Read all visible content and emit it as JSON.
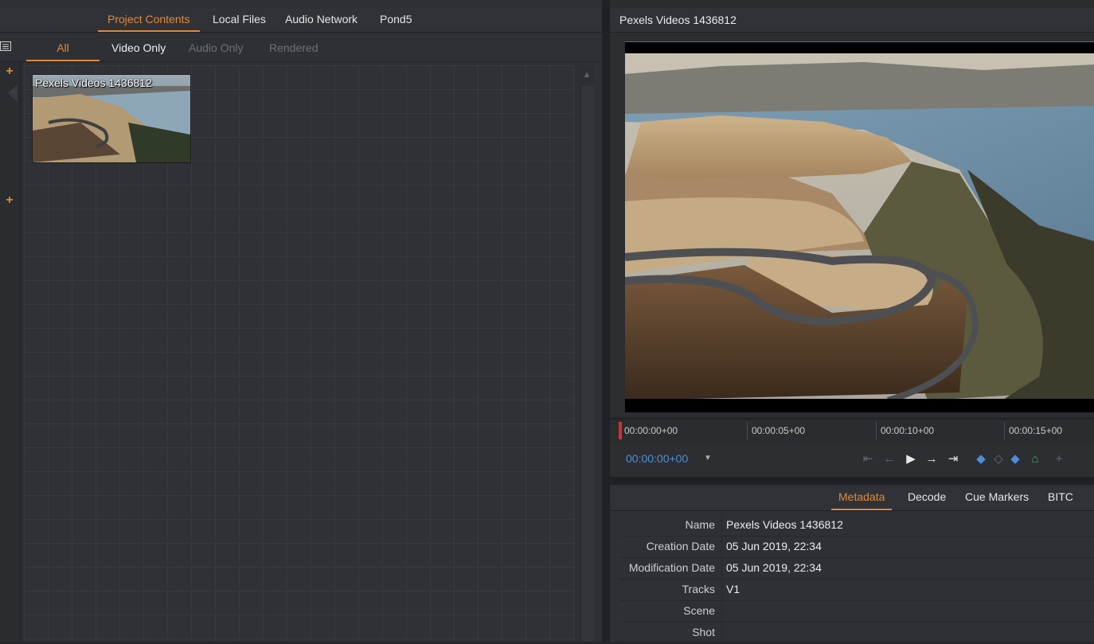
{
  "left_panel": {
    "tabs": [
      "Project Contents",
      "Local Files",
      "Audio Network",
      "Pond5"
    ],
    "active_tab": "Project Contents",
    "filters": [
      "All",
      "Video Only",
      "Audio Only",
      "Rendered"
    ],
    "active_filter": "All",
    "clips": [
      {
        "title": "Pexels Videos 1436812"
      }
    ]
  },
  "viewer": {
    "title": "Pexels Videos 1436812",
    "ruler_timecodes": [
      "00:00:00+00",
      "00:00:05+00",
      "00:00:10+00",
      "00:00:15+00"
    ],
    "current_timecode": "00:00:00+00"
  },
  "metadata": {
    "tabs": [
      "Metadata",
      "Decode",
      "Cue Markers",
      "BITC"
    ],
    "active_tab": "Metadata",
    "rows": [
      {
        "label": "Name",
        "value": "Pexels Videos 1436812"
      },
      {
        "label": "Creation Date",
        "value": "05 Jun 2019, 22:34"
      },
      {
        "label": "Modification Date",
        "value": "05 Jun 2019, 22:34"
      },
      {
        "label": "Tracks",
        "value": "V1"
      },
      {
        "label": "Scene",
        "value": ""
      },
      {
        "label": "Shot",
        "value": ""
      }
    ]
  },
  "icons": {
    "list_view": "list-view-icon",
    "add": "plus-icon",
    "transport": [
      "go-to-start-icon",
      "step-back-icon",
      "play-icon",
      "step-forward-icon",
      "go-to-end-icon",
      "mark-in-icon",
      "add-marker-icon",
      "mark-out-icon",
      "home-icon",
      "plus-icon"
    ]
  },
  "colors": {
    "accent": "#e08a3c",
    "timecode_blue": "#4d8ed6",
    "playhead": "#d8302a"
  }
}
